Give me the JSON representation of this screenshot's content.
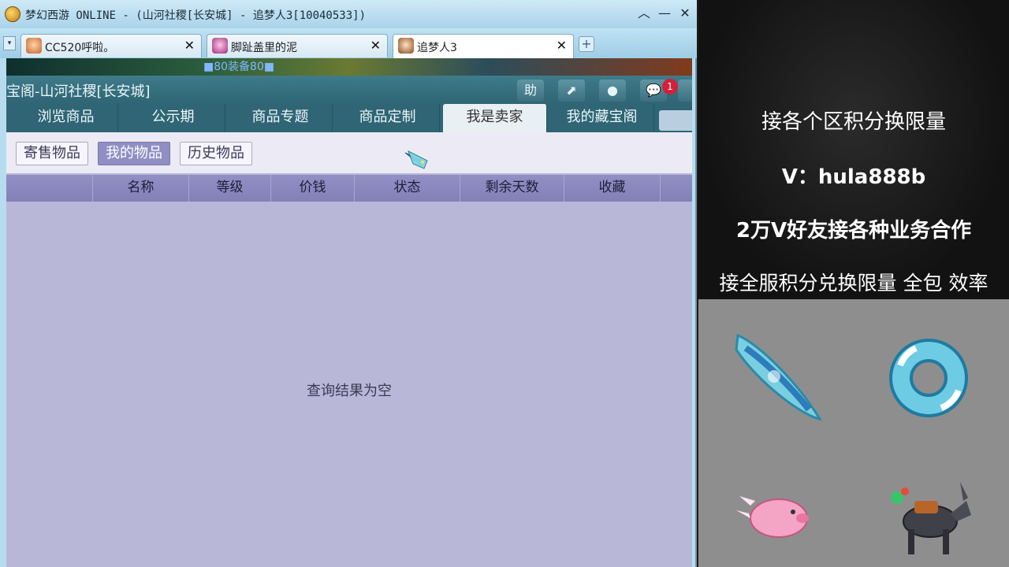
{
  "window": {
    "title": "梦幻西游 ONLINE - (山河社稷[长安城] - 追梦人3[10040533])",
    "collapse_glyph": "︿",
    "minimize_glyph": "—",
    "close_glyph": "✕"
  },
  "tabs": [
    {
      "label": "CC520呼啦。",
      "close": "✕",
      "active": false
    },
    {
      "label": "脚趾盖里的泥",
      "close": "✕",
      "active": false
    },
    {
      "label": "追梦人3",
      "close": "✕",
      "active": true
    }
  ],
  "tab_new_glyph": "+",
  "tab_menu_glyph": "▾",
  "game_strip_text": "■80装备80■",
  "shop": {
    "title": "宝阁-山河社稷[长安城]",
    "header_buttons": {
      "help": "助",
      "share": "⬈",
      "record": "●",
      "chat": "💬"
    },
    "unread_count": "1",
    "nav": [
      {
        "label": "浏览商品",
        "active": false
      },
      {
        "label": "公示期",
        "active": false
      },
      {
        "label": "商品专题",
        "active": false
      },
      {
        "label": "商品定制",
        "active": false
      },
      {
        "label": "我是卖家",
        "active": true
      },
      {
        "label": "我的藏宝阁",
        "active": false
      }
    ],
    "subnav": [
      {
        "label": "寄售物品",
        "active": false
      },
      {
        "label": "我的物品",
        "active": true
      },
      {
        "label": "历史物品",
        "active": false
      }
    ],
    "columns": [
      "名称",
      "等级",
      "价钱",
      "状态",
      "剩余天数",
      "收藏"
    ],
    "empty_message": "查询结果为空"
  },
  "overlay": {
    "lines": [
      "接各个区积分换限量",
      "V：hula888b",
      "2万V好友接各种业务合作",
      "接全服积分兑换限量 全包 效率"
    ]
  },
  "colors": {
    "accent_teal": "#2f6574",
    "table_header": "#8a87bf",
    "table_body": "#b9b7d8",
    "badge_red": "#d3203a"
  }
}
